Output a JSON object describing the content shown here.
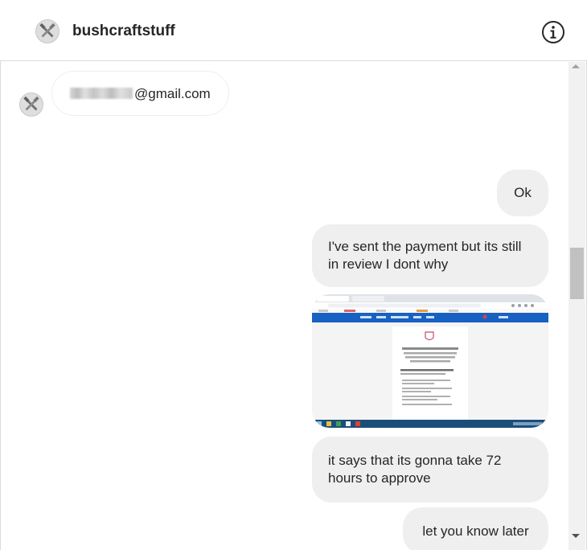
{
  "header": {
    "title": "bushcraftstuff",
    "avatar_icon": "tools-logo-icon",
    "info_icon": "info-icon"
  },
  "messages": [
    {
      "direction": "incoming",
      "text_visible": "@gmail.com",
      "redacted_prefix": true
    },
    {
      "direction": "outgoing",
      "text": "Ok"
    },
    {
      "direction": "outgoing",
      "text": "I've sent the payment but its still in review I dont why"
    },
    {
      "direction": "outgoing",
      "type": "image",
      "description": "payment-review-screenshot"
    },
    {
      "direction": "outgoing",
      "text": "it says that its gonna take 72 hours to approve"
    },
    {
      "direction": "outgoing",
      "text": "let you know later"
    }
  ],
  "colors": {
    "bubble_out": "#efefef",
    "border": "#dbdbdb",
    "paypal_blue": "#1761c2",
    "text": "#262626"
  }
}
